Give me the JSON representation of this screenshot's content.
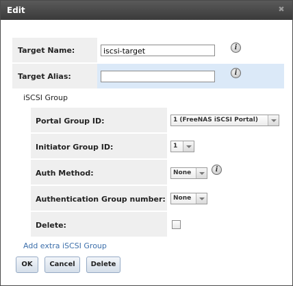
{
  "dialog": {
    "title": "Edit",
    "close_icon": "close-icon"
  },
  "form": {
    "target_name": {
      "label": "Target Name:",
      "value": "iscsi-target"
    },
    "target_alias": {
      "label": "Target Alias:",
      "value": ""
    }
  },
  "group": {
    "heading": "iSCSI Group",
    "portal_group": {
      "label": "Portal Group ID:",
      "selected": "1 (FreeNAS iSCSI Portal)"
    },
    "initiator_group": {
      "label": "Initiator Group ID:",
      "selected": "1"
    },
    "auth_method": {
      "label": "Auth Method:",
      "selected": "None"
    },
    "auth_group": {
      "label": "Authentication Group number:",
      "selected": "None"
    },
    "delete": {
      "label": "Delete:",
      "checked": false
    }
  },
  "add_link": "Add extra iSCSI Group",
  "buttons": {
    "ok": "OK",
    "cancel": "Cancel",
    "delete": "Delete"
  },
  "colors": {
    "titlebar": "#4a4a4a",
    "highlight_row": "#dbe9f8",
    "label_cell": "#efefef",
    "link": "#3b6eaa"
  }
}
